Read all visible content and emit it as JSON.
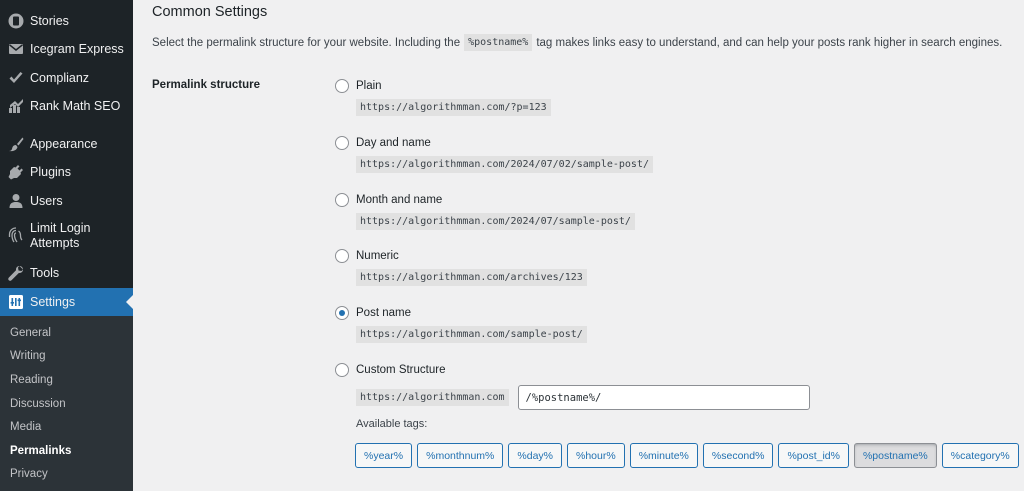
{
  "sidebar": {
    "items": [
      {
        "label": "Stories",
        "icon": "stories-icon"
      },
      {
        "label": "Icegram Express",
        "icon": "mail-icon"
      },
      {
        "label": "Complianz",
        "icon": "check-icon"
      },
      {
        "label": "Rank Math SEO",
        "icon": "chart-icon"
      },
      {
        "label": "Appearance",
        "icon": "brush-icon"
      },
      {
        "label": "Plugins",
        "icon": "plugin-icon"
      },
      {
        "label": "Users",
        "icon": "user-icon"
      },
      {
        "label": "Limit Login Attempts",
        "icon": "fingerprint-icon"
      },
      {
        "label": "Tools",
        "icon": "wrench-icon"
      },
      {
        "label": "Settings",
        "icon": "settings-icon"
      }
    ],
    "submenu": [
      "General",
      "Writing",
      "Reading",
      "Discussion",
      "Media",
      "Permalinks",
      "Privacy"
    ]
  },
  "main": {
    "section_title": "Common Settings",
    "intro_before": "Select the permalink structure for your website. Including the",
    "intro_code": "%postname%",
    "intro_after": "tag makes links easy to understand, and can help your posts rank higher in search engines.",
    "permalink_label": "Permalink structure",
    "options": [
      {
        "label": "Plain",
        "example": "https://algorithmman.com/?p=123",
        "checked": false
      },
      {
        "label": "Day and name",
        "example": "https://algorithmman.com/2024/07/02/sample-post/",
        "checked": false
      },
      {
        "label": "Month and name",
        "example": "https://algorithmman.com/2024/07/sample-post/",
        "checked": false
      },
      {
        "label": "Numeric",
        "example": "https://algorithmman.com/archives/123",
        "checked": false
      },
      {
        "label": "Post name",
        "example": "https://algorithmman.com/sample-post/",
        "checked": true
      },
      {
        "label": "Custom Structure",
        "example": "",
        "checked": false
      }
    ],
    "custom_base": "https://algorithmman.com",
    "custom_value": "/%postname%/",
    "available_tags_label": "Available tags:",
    "tags": [
      "%year%",
      "%monthnum%",
      "%day%",
      "%hour%",
      "%minute%",
      "%second%",
      "%post_id%",
      "%postname%",
      "%category%"
    ],
    "active_tag": "%postname%"
  },
  "colors": {
    "accent": "#2271b1",
    "sidebar": "#1d2327",
    "submenu": "#2c3338"
  }
}
